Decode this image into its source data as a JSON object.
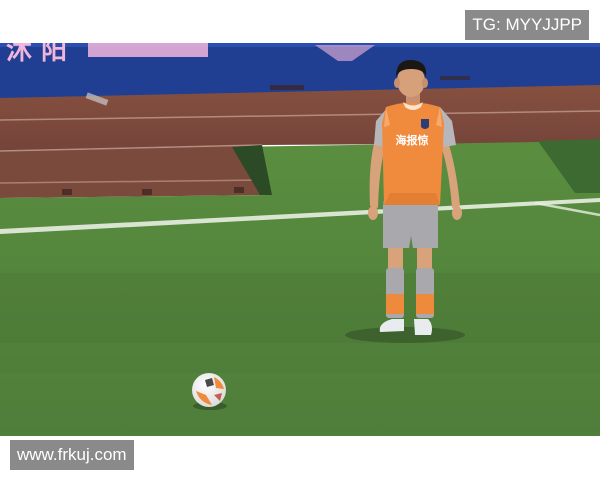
{
  "watermark_top": "TG: MYYJJPP",
  "watermark_bottom": "www.frkuj.com",
  "board_text": "沭 阳",
  "jersey_text": "海报惊",
  "colors": {
    "board_blue": "#1f3e8e",
    "track": "#7e4a3d",
    "pitch": "#4f7f3c",
    "kit_orange": "#f08a3c",
    "kit_grey": "#a8a8ac"
  }
}
